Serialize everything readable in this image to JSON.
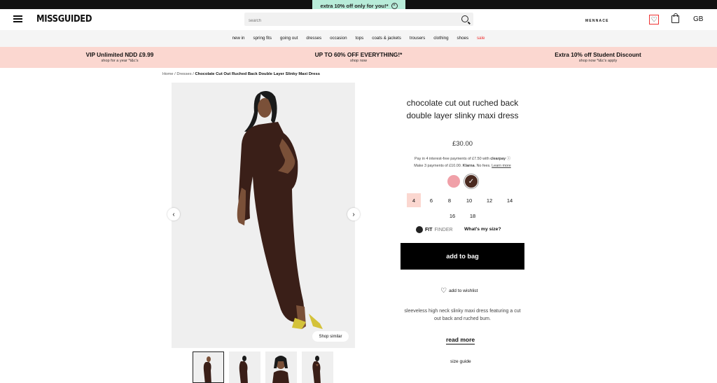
{
  "promo": {
    "text": "extra 10% off only for you!*"
  },
  "header": {
    "logo": "MISSGUIDED",
    "search_placeholder": "search",
    "mennace": "MENNACE",
    "region": "GB"
  },
  "nav": [
    "new in",
    "spring fits",
    "going out",
    "dresses",
    "occasion",
    "tops",
    "coats & jackets",
    "trousers",
    "clothing",
    "shoes",
    "sale"
  ],
  "deals": [
    {
      "title": "VIP Unlimited NDD £9.99",
      "sub": "shop for a year *t&c's"
    },
    {
      "title": "UP TO 60% OFF EVERYTHING!*",
      "sub": "shop now"
    },
    {
      "title": "Extra 10% off Student Discount",
      "sub": "shop now *t&c's apply"
    }
  ],
  "breadcrumb": {
    "home": "Home",
    "sep": "/",
    "category": "Dresses",
    "current": "Chocolate Cut Out Ruched Back Double Layer Slinky Maxi Dress"
  },
  "gallery": {
    "shop_similar": "Shop similar"
  },
  "product": {
    "title": "chocolate cut out ruched back double layer slinky maxi dress",
    "price": "£30.00",
    "clearpay": "Pay in 4 interest-free payments of £7.50 with",
    "clearpay_brand": "clearpay",
    "klarna": "Make 3 payments of £10.00.",
    "klarna_brand": "Klarna",
    "klarna_fees": ". No fees.",
    "learn_more": "Learn more",
    "colors": [
      "#f0a0a8",
      "#4a2a20"
    ],
    "sizes": [
      "4",
      "6",
      "8",
      "10",
      "12",
      "14",
      "16",
      "18"
    ],
    "fit_finder_a": "FIT",
    "fit_finder_b": "FINDER",
    "whats_my_size": "What's my size?",
    "add_to_bag": "add to bag",
    "add_to_wishlist": "add to wishlist",
    "description": "sleeveless high neck slinky maxi dress featuring a cut out back and ruched bum.",
    "read_more": "read more",
    "size_guide": "size guide"
  }
}
